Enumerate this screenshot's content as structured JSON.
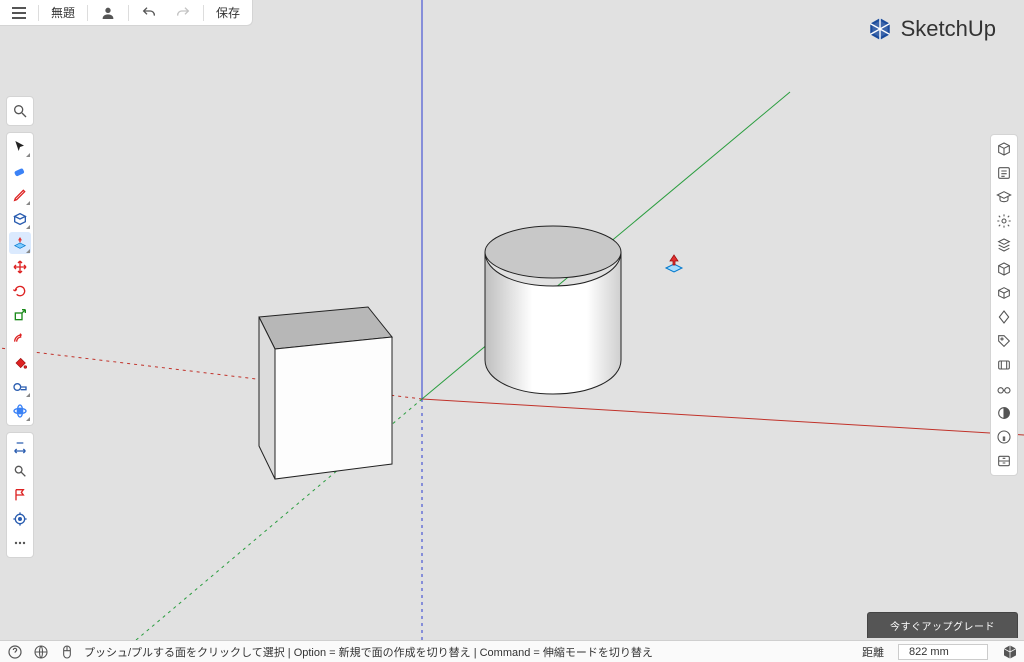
{
  "app": {
    "brand": "SketchUp"
  },
  "topbar": {
    "title": "無題",
    "save": "保存"
  },
  "left_tools": {
    "search": "search",
    "groups": [
      [
        "select",
        "eraser",
        "line",
        "rectangle",
        "push-pull",
        "move",
        "rotate",
        "scale",
        "offset",
        "paint-bucket",
        "tape-measure",
        "orbit"
      ],
      [
        "dimension",
        "section",
        "text-label",
        "axes",
        "more"
      ]
    ],
    "active": "push-pull"
  },
  "right_tools": [
    "entity-info",
    "instructor",
    "outliner",
    "components",
    "materials",
    "tags",
    "layers",
    "scenes",
    "styles",
    "shadows",
    "fog",
    "soft-edges",
    "info",
    "advanced"
  ],
  "scene": {
    "objects": [
      {
        "type": "cube"
      },
      {
        "type": "cylinder"
      }
    ],
    "cursor": "push-pull"
  },
  "upgrade": {
    "label": "今すぐアップグレード"
  },
  "status": {
    "hint": "プッシュ/プルする面をクリックして選択 | Option = 新規で面の作成を切り替え | Command = 伸縮モードを切り替え",
    "measure_label": "距離",
    "measure_value": "822 mm"
  }
}
